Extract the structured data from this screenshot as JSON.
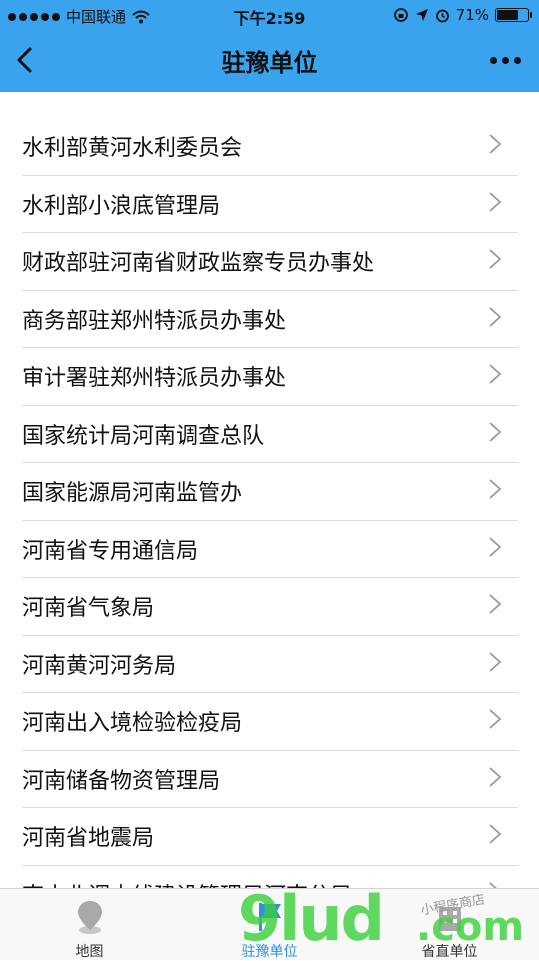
{
  "status_bar": {
    "carrier": "中国联通",
    "time": "下午2:59",
    "battery_text": "71%",
    "battery_level": 0.71
  },
  "nav": {
    "title": "驻豫单位"
  },
  "list": [
    {
      "label": "水利部黄河水利委员会"
    },
    {
      "label": "水利部小浪底管理局"
    },
    {
      "label": "财政部驻河南省财政监察专员办事处"
    },
    {
      "label": "商务部驻郑州特派员办事处"
    },
    {
      "label": "审计署驻郑州特派员办事处"
    },
    {
      "label": "国家统计局河南调查总队"
    },
    {
      "label": "国家能源局河南监管办"
    },
    {
      "label": "河南省专用通信局"
    },
    {
      "label": "河南省气象局"
    },
    {
      "label": "河南黄河河务局"
    },
    {
      "label": "河南出入境检验检疫局"
    },
    {
      "label": "河南储备物资管理局"
    },
    {
      "label": "河南省地震局"
    },
    {
      "label": "南水北调中线建设管理局河南分局"
    }
  ],
  "tabs": [
    {
      "label": "地图",
      "icon": "map-pin-icon",
      "active": false
    },
    {
      "label": "驻豫单位",
      "icon": "flag-icon",
      "active": true
    },
    {
      "label": "省直单位",
      "icon": "building-icon",
      "active": false
    }
  ],
  "watermark": {
    "main": "9lud",
    "suffix": ".com",
    "small": "小程序商店"
  },
  "colors": {
    "header_bg": "#3aa3ee",
    "active_tab": "#2f8fe0",
    "watermark": "#3ad13a"
  }
}
